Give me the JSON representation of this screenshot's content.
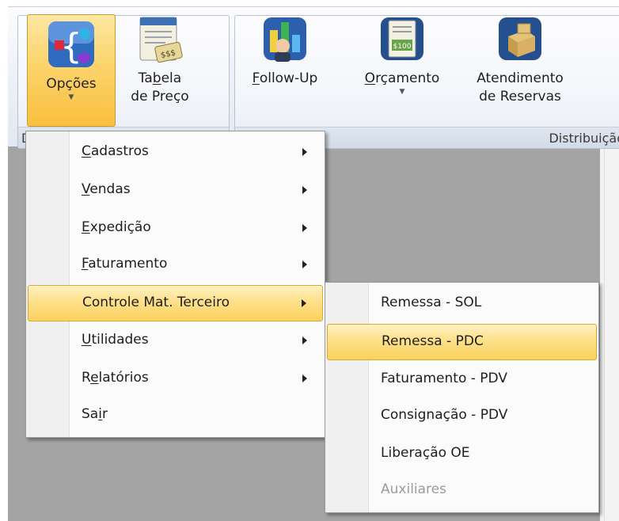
{
  "ribbon": {
    "group1_label": "D",
    "group2_label": "Distribuição",
    "buttons": [
      {
        "pre": "",
        "u": "",
        "post": "Opções",
        "line2": "",
        "icon": "options-brackets-icon"
      },
      {
        "pre": "Ta",
        "u": "b",
        "post": "ela",
        "line2": "de Preço",
        "icon": "price-table-icon"
      },
      {
        "pre": "",
        "u": "F",
        "post": "ollow-Up",
        "line2": "",
        "icon": "follow-up-icon"
      },
      {
        "pre": "",
        "u": "O",
        "post": "rçamento",
        "line2": "",
        "icon": "budget-icon"
      },
      {
        "pre": "Atendimento",
        "u": "",
        "post": "",
        "line2": "de Reservas",
        "icon": "reservations-icon"
      }
    ]
  },
  "main_menu": {
    "items": [
      {
        "pre": "",
        "u": "C",
        "post": "adastros",
        "submenu": true
      },
      {
        "pre": "",
        "u": "V",
        "post": "endas",
        "submenu": true
      },
      {
        "pre": "",
        "u": "E",
        "post": "xpedição",
        "submenu": true
      },
      {
        "pre": "",
        "u": "F",
        "post": "aturamento",
        "submenu": true
      },
      {
        "pre": "Controle Mat. Terceiro",
        "u": "",
        "post": "",
        "submenu": true
      },
      {
        "pre": "",
        "u": "U",
        "post": "tilidades",
        "submenu": true
      },
      {
        "pre": "R",
        "u": "e",
        "post": "latórios",
        "submenu": true
      },
      {
        "pre": "Sa",
        "u": "i",
        "post": "r",
        "submenu": false
      }
    ]
  },
  "sub_menu": {
    "items": [
      {
        "label": "Remessa - SOL"
      },
      {
        "label": "Remessa - PDC"
      },
      {
        "label": "Faturamento - PDV"
      },
      {
        "label": "Consignação - PDV"
      },
      {
        "label": "Liberação OE"
      },
      {
        "label": "Auxiliares"
      }
    ]
  },
  "colors": {
    "highlight": "#fcd25d",
    "workspace": "#a4a4a4",
    "ribbon": "#e2e8f1"
  }
}
